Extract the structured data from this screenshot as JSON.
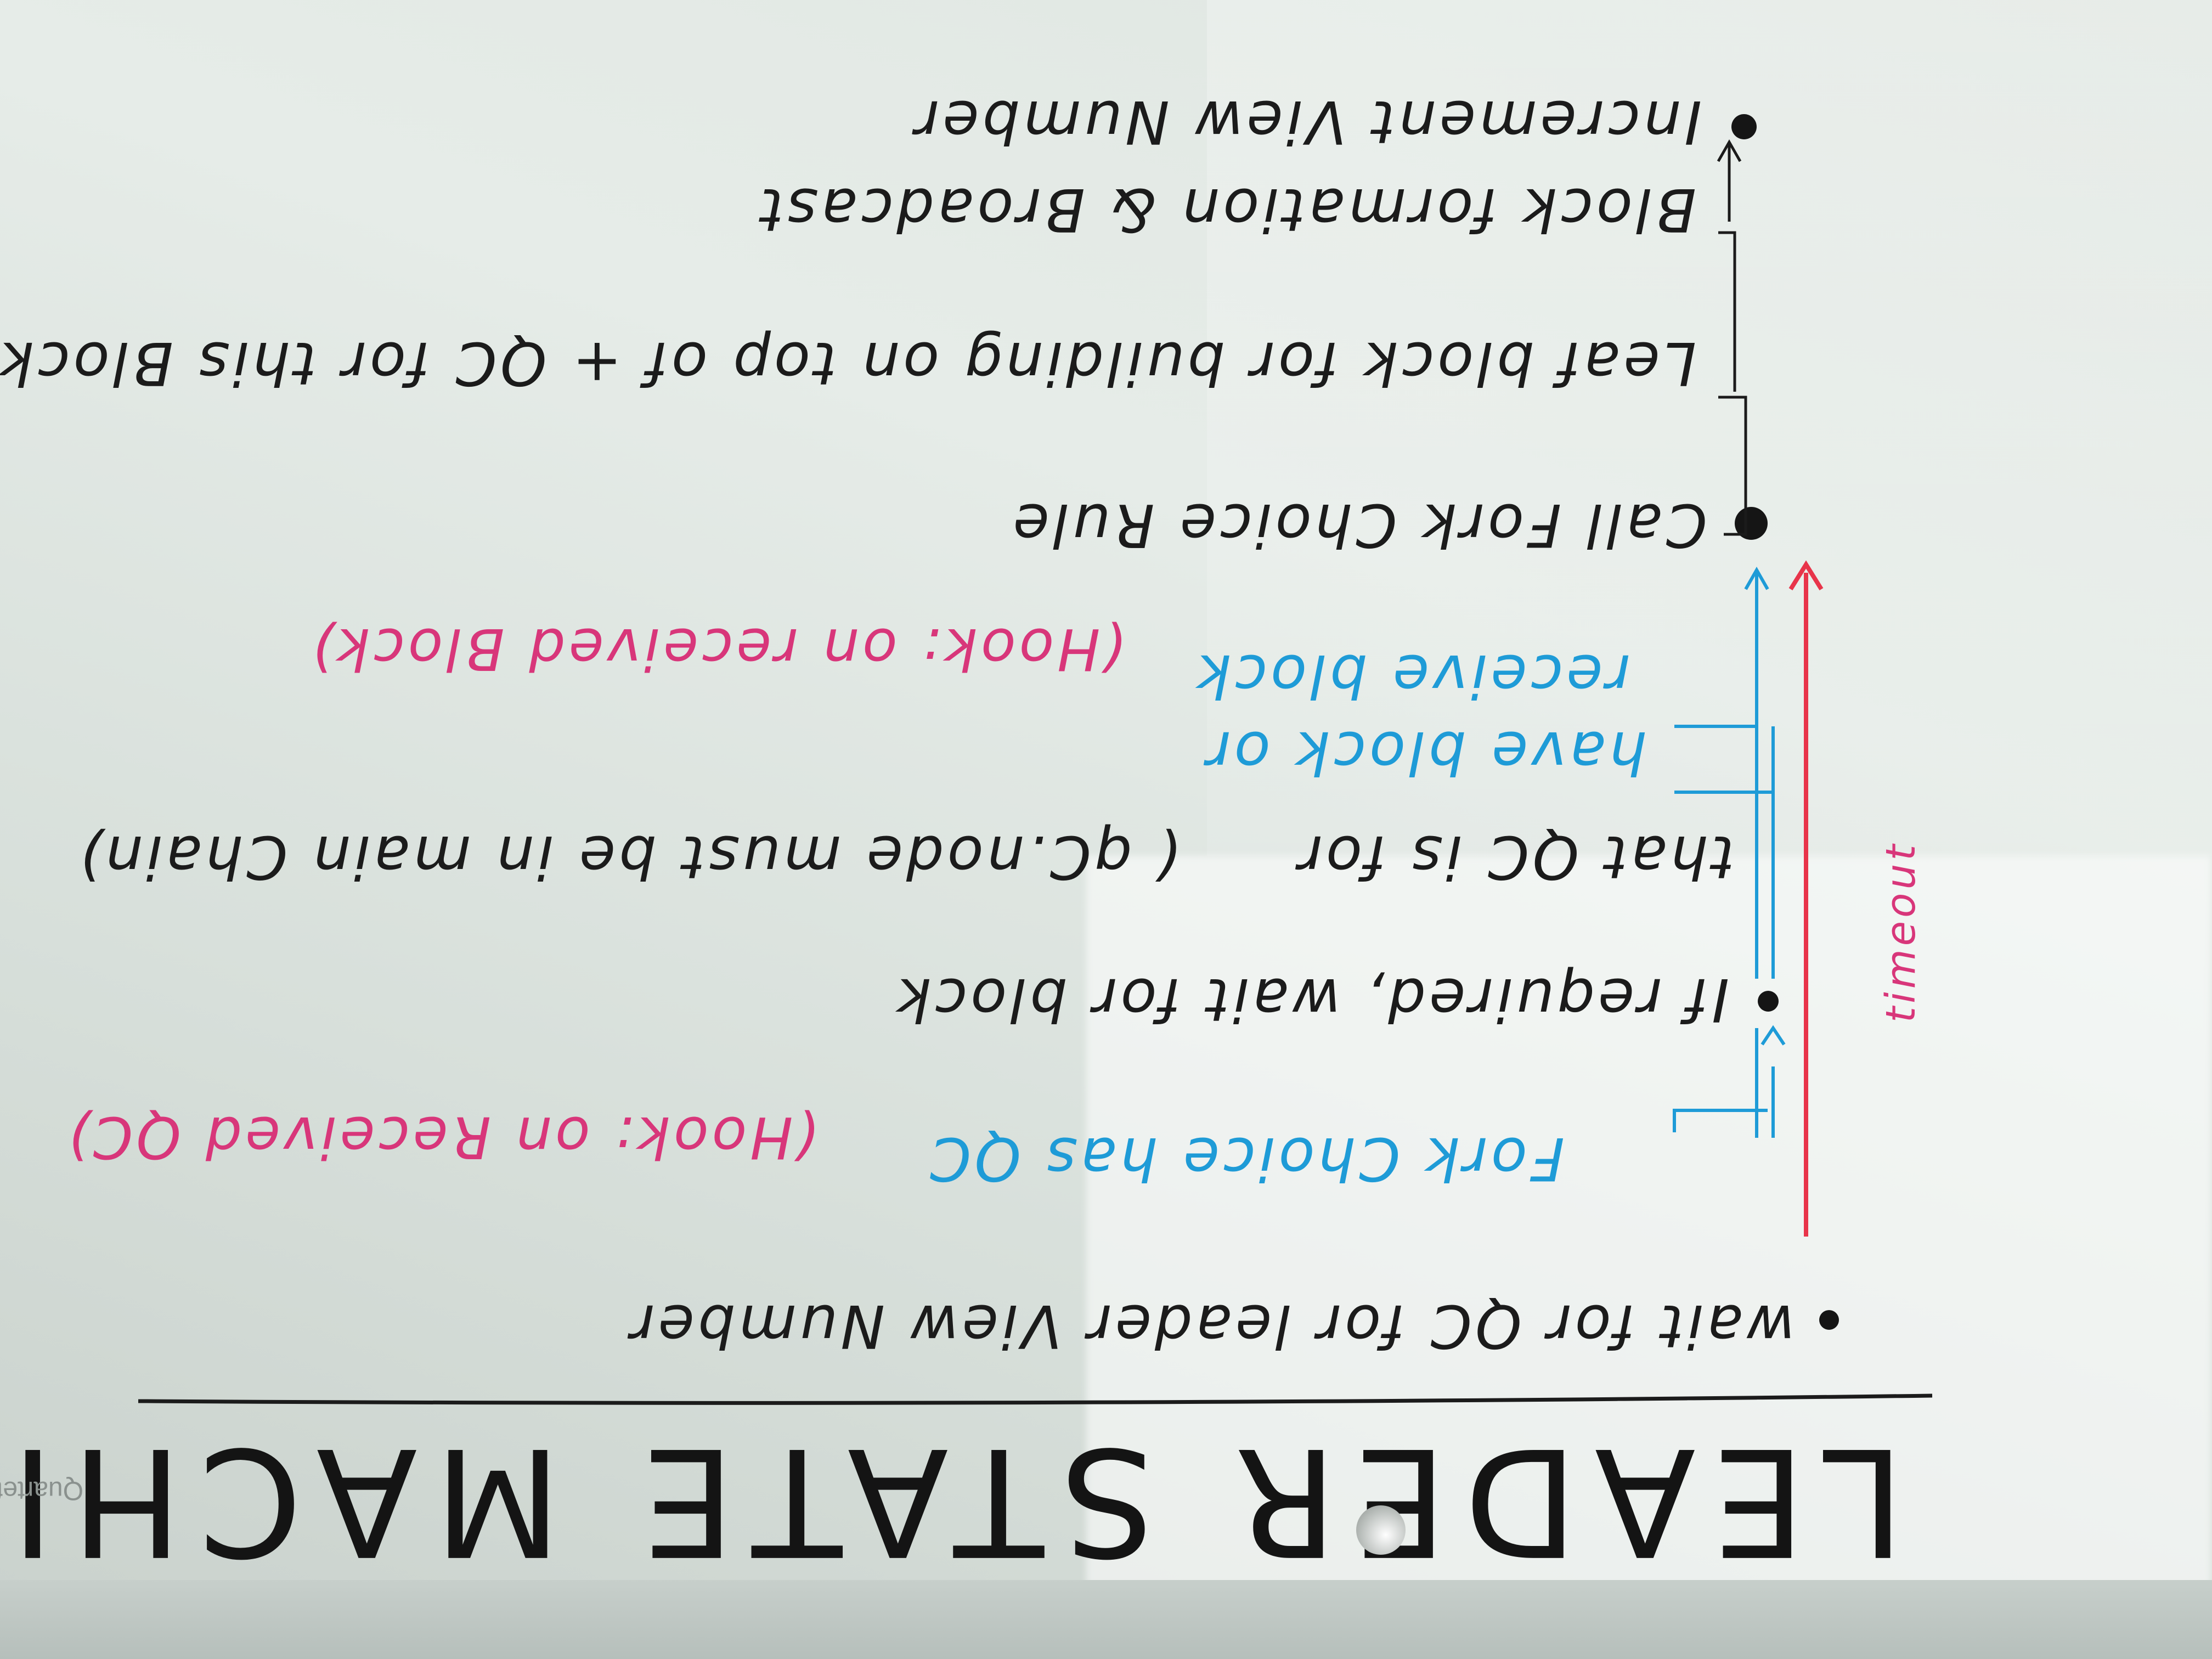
{
  "whiteboard": {
    "title": "LEADER STATE MACHINE",
    "brand": "Quartet",
    "steps": [
      {
        "text": "wait for QC for leader View Number"
      },
      {
        "text": "If required, wait for block"
      },
      {
        "text": "Call Fork Choice Rule"
      },
      {
        "text": "Increment View Number"
      }
    ],
    "notes": {
      "fork_choice_has_qc": "Fork Choice has QC",
      "hook_received_qc": "(Hook: on Received QC)",
      "that_qc_is_for": "that QC is for",
      "main_chain_note": "( qC.node must be in main Chain)",
      "have_block_or": "have block or",
      "receive_block": "receive block",
      "hook_received_block": "(Hook: on received Block)",
      "leaf_block": "Leaf block for building on top of + QC for this Block",
      "block_formation": "Block formation & Broadcast",
      "timeout": "timeout"
    },
    "colors": {
      "marker_black": "#1b1b1b",
      "marker_blue": "#1e9bd7",
      "marker_pink": "#d8367a",
      "marker_red": "#e8344a"
    }
  }
}
